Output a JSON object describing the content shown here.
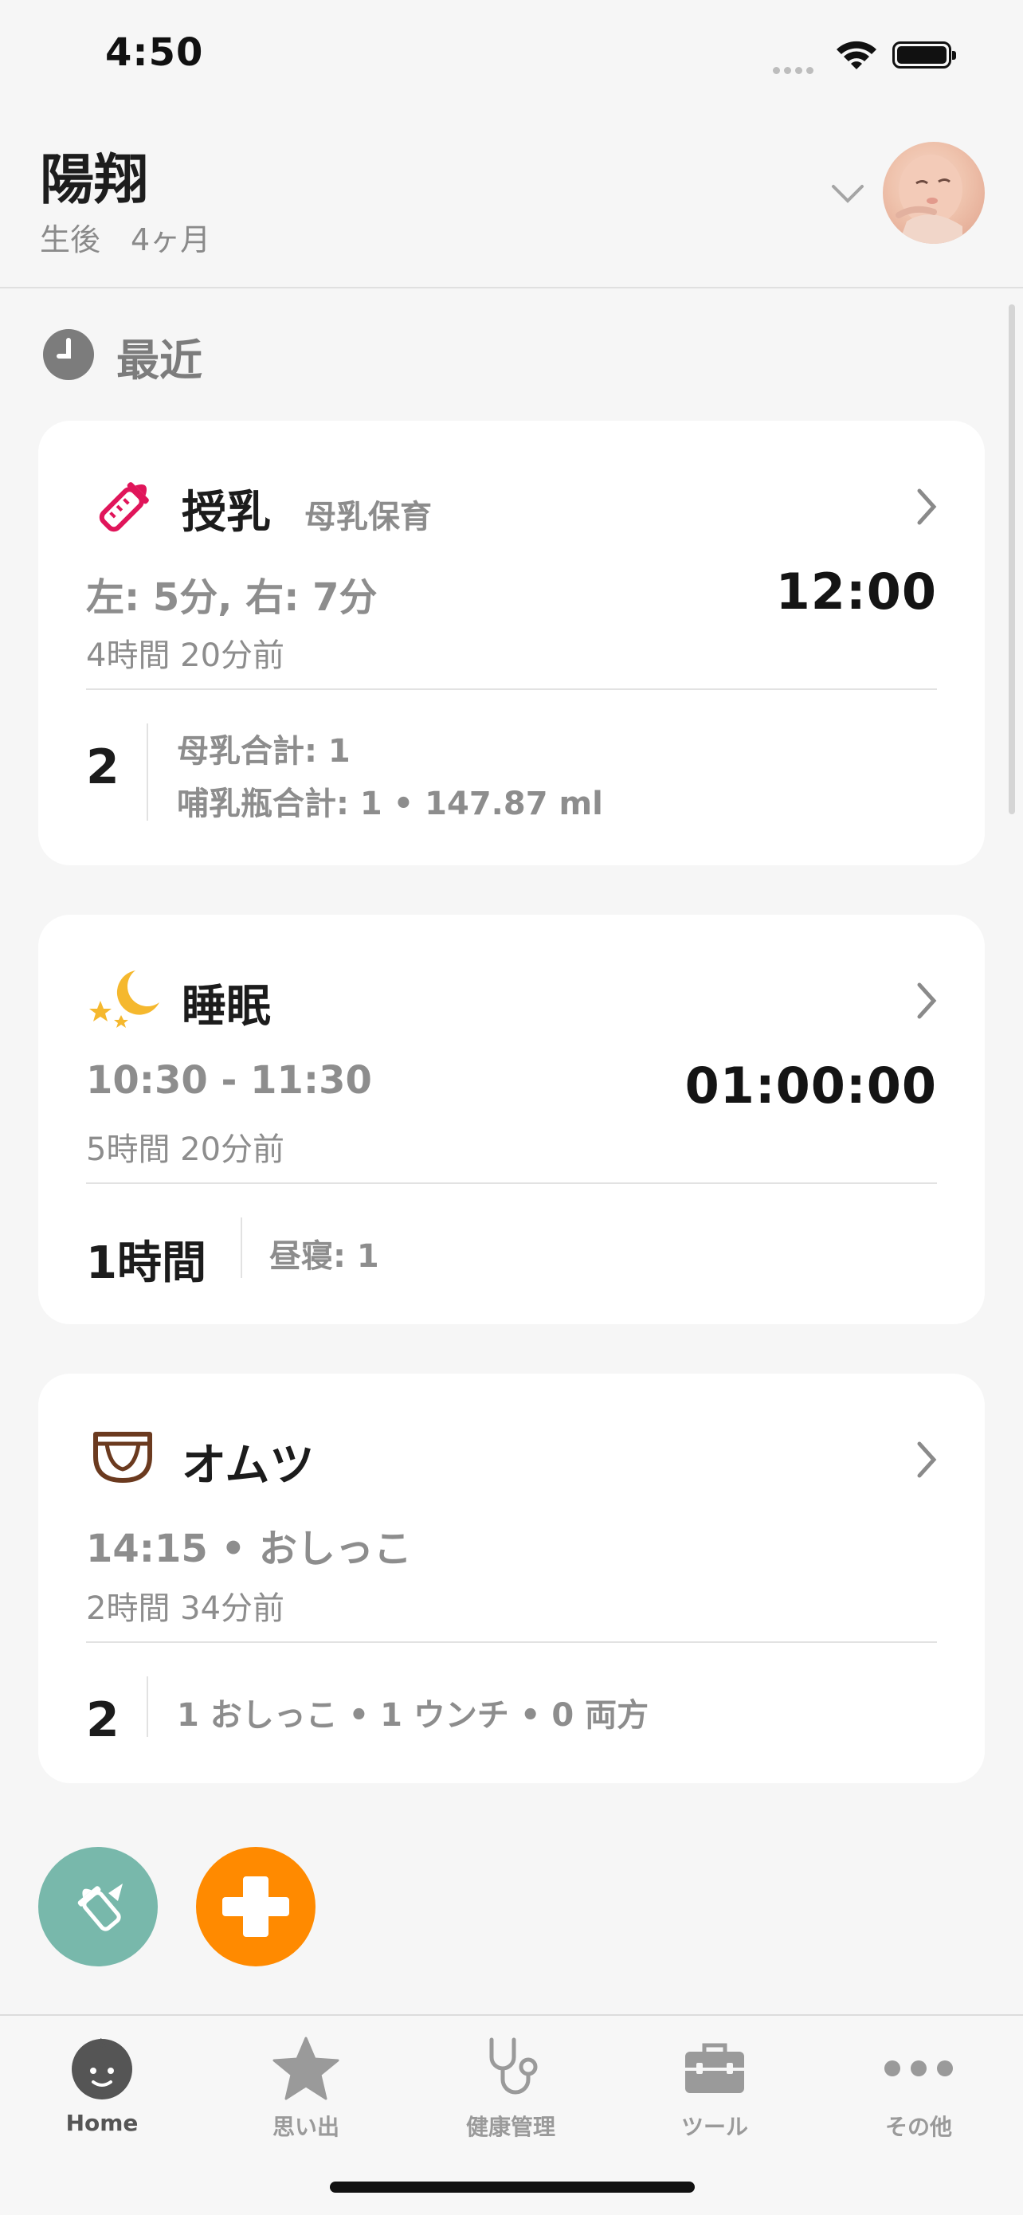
{
  "status_bar": {
    "time": "4:50"
  },
  "header": {
    "child_name": "陽翔",
    "child_age": "生後　4ヶ月"
  },
  "section": {
    "title": "最近"
  },
  "cards": {
    "feeding": {
      "title": "授乳",
      "subtitle": "母乳保育",
      "detail": "左: 5分, 右: 7分",
      "time": "12:00",
      "ago": "4時間 20分前",
      "count": "2",
      "stat1": "母乳合計: 1",
      "stat2": "哺乳瓶合計: 1 • 147.87 ml"
    },
    "sleep": {
      "title": "睡眠",
      "detail": "10:30 - 11:30",
      "duration": "01:00:00",
      "ago": "5時間 20分前",
      "count": "1時間",
      "stat1": "昼寝: 1"
    },
    "diaper": {
      "title": "オムツ",
      "detail": "14:15 • おしっこ",
      "ago": "2時間 34分前",
      "count": "2",
      "stat1": "1 おしっこ • 1 ウンチ • 0 両方"
    }
  },
  "tabs": [
    {
      "label": "Home",
      "icon": "baby-face-icon",
      "active": true
    },
    {
      "label": "思い出",
      "icon": "star-icon"
    },
    {
      "label": "健康管理",
      "icon": "stethoscope-icon"
    },
    {
      "label": "ツール",
      "icon": "toolbox-icon"
    },
    {
      "label": "その他",
      "icon": "more-dots-icon"
    }
  ],
  "colors": {
    "accent_orange": "#ff8a00",
    "quick_action_teal": "#78b8ab",
    "feeding_pink": "#e0155a",
    "sleep_yellow": "#f5b82e",
    "diaper_brown": "#6b3a1f"
  }
}
